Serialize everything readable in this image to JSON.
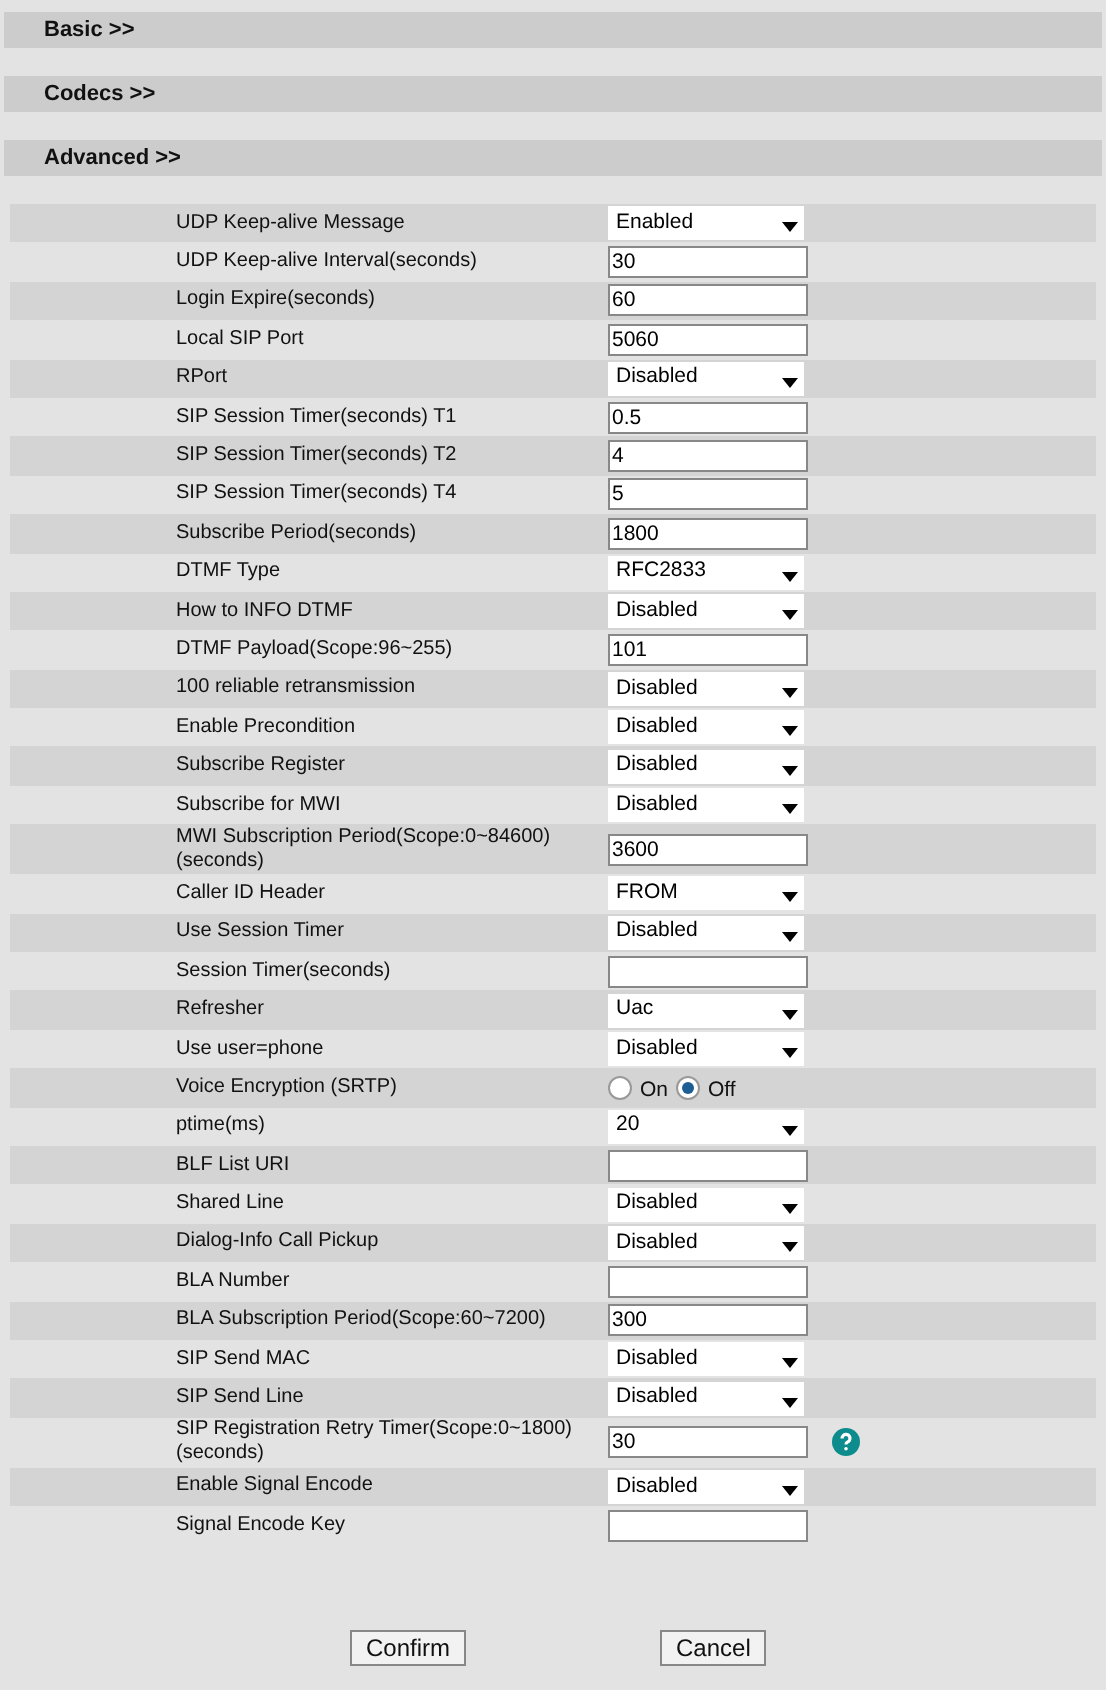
{
  "sections": [
    {
      "title": "Basic >>"
    },
    {
      "title": "Codecs >>"
    },
    {
      "title": "Advanced >>"
    }
  ],
  "rows": [
    {
      "kind": "select",
      "label": "UDP Keep-alive Message",
      "value": "Enabled"
    },
    {
      "kind": "input",
      "label": "UDP Keep-alive Interval(seconds)",
      "value": "30"
    },
    {
      "kind": "input",
      "label": "Login Expire(seconds)",
      "value": "60"
    },
    {
      "kind": "input",
      "label": "Local SIP Port",
      "value": "5060"
    },
    {
      "kind": "select",
      "label": "RPort",
      "value": "Disabled"
    },
    {
      "kind": "input",
      "label": "SIP Session Timer(seconds)  T1",
      "value": "0.5"
    },
    {
      "kind": "input",
      "label": "SIP Session Timer(seconds)  T2",
      "value": "4"
    },
    {
      "kind": "input",
      "label": "SIP Session Timer(seconds)  T4",
      "value": "5"
    },
    {
      "kind": "input",
      "label": "Subscribe Period(seconds)",
      "value": "1800"
    },
    {
      "kind": "select",
      "label": "DTMF Type",
      "value": "RFC2833"
    },
    {
      "kind": "select",
      "label": "How to INFO DTMF",
      "value": "Disabled"
    },
    {
      "kind": "input",
      "label": "DTMF Payload(Scope:96~255)",
      "value": "101"
    },
    {
      "kind": "select",
      "label": "100 reliable retransmission",
      "value": "Disabled"
    },
    {
      "kind": "select",
      "label": "Enable Precondition",
      "value": "Disabled"
    },
    {
      "kind": "select",
      "label": "Subscribe Register",
      "value": "Disabled"
    },
    {
      "kind": "select",
      "label": "Subscribe for MWI",
      "value": "Disabled"
    },
    {
      "kind": "input",
      "label": "MWI Subscription Period(Scope:0~84600) (seconds)",
      "value": "3600"
    },
    {
      "kind": "select",
      "label": "Caller ID Header",
      "value": "FROM"
    },
    {
      "kind": "select",
      "label": "Use Session Timer",
      "value": "Disabled"
    },
    {
      "kind": "input",
      "label": "Session Timer(seconds)"
    },
    {
      "kind": "select",
      "label": "Refresher",
      "value": "Uac"
    },
    {
      "kind": "select",
      "label": "Use user=phone",
      "value": "Disabled"
    },
    {
      "kind": "radio",
      "label": "Voice Encryption (SRTP)",
      "options": [
        {
          "label": "On",
          "selected": false
        },
        {
          "label": "Off",
          "selected": true
        }
      ]
    },
    {
      "kind": "select",
      "label": "ptime(ms)",
      "value": "20"
    },
    {
      "kind": "input",
      "label": "BLF List URI"
    },
    {
      "kind": "select",
      "label": "Shared Line",
      "value": "Disabled"
    },
    {
      "kind": "select",
      "label": "Dialog-Info Call Pickup",
      "value": "Disabled"
    },
    {
      "kind": "input",
      "label": "BLA Number"
    },
    {
      "kind": "input",
      "label": "BLA Subscription Period(Scope:60~7200)",
      "value": "300"
    },
    {
      "kind": "select",
      "label": "SIP Send MAC",
      "value": "Disabled"
    },
    {
      "kind": "select",
      "label": "SIP Send Line",
      "value": "Disabled"
    },
    {
      "kind": "input",
      "label": "SIP Registration Retry Timer(Scope:0~1800) (seconds)",
      "value": "30",
      "help": true
    },
    {
      "kind": "select",
      "label": "Enable Signal Encode",
      "value": "Disabled"
    },
    {
      "kind": "input",
      "label": "Signal Encode Key"
    }
  ],
  "buttons": [
    "Confirm",
    "Cancel"
  ]
}
